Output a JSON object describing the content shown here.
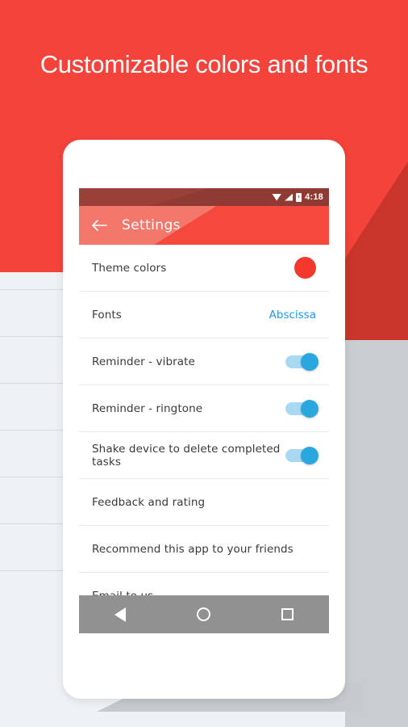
{
  "promo": {
    "headline": "Customizable colors and fonts",
    "background_color": "#f4433a",
    "lower_background_color": "#eff2f5"
  },
  "statusbar": {
    "time": "4:18",
    "icons": [
      "wifi-icon",
      "signal-icon",
      "battery-charging-icon"
    ],
    "background_color": "#9a4038"
  },
  "toolbar": {
    "back_icon": "arrow-left-icon",
    "title": "Settings",
    "background_color": "#f4776c"
  },
  "settings": {
    "rows": [
      {
        "label": "Theme colors",
        "type": "color",
        "value_color": "#f4392c"
      },
      {
        "label": "Fonts",
        "type": "value",
        "value": "Abscissa",
        "value_color": "#2196f3"
      },
      {
        "label": "Reminder - vibrate",
        "type": "toggle",
        "on": true
      },
      {
        "label": "Reminder - ringtone",
        "type": "toggle",
        "on": true
      },
      {
        "label": "Shake device to delete completed tasks",
        "type": "toggle",
        "on": true
      },
      {
        "label": "Feedback and rating",
        "type": "plain"
      },
      {
        "label": "Recommend this app to your friends",
        "type": "plain"
      },
      {
        "label": "Email to us",
        "type": "plain"
      }
    ]
  },
  "navbar": {
    "back_label": "Back",
    "home_label": "Home",
    "recents_label": "Recents",
    "background_color": "#919191"
  }
}
